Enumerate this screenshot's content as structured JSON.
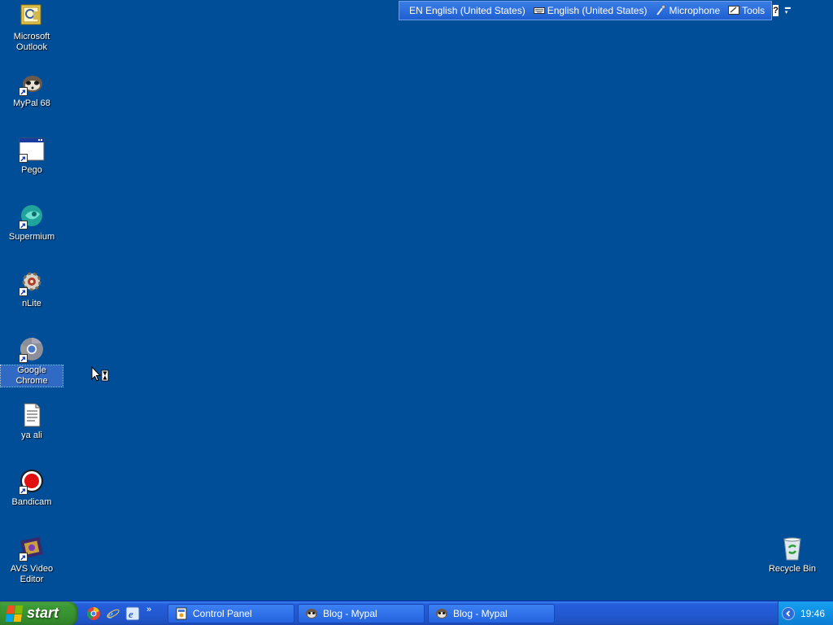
{
  "desktop": {
    "icons": [
      {
        "label": "Microsoft Outlook",
        "icon": "outlook-icon"
      },
      {
        "label": "MyPal 68",
        "icon": "mypal-icon"
      },
      {
        "label": "Pego",
        "icon": "pego-window-icon"
      },
      {
        "label": "Supermium",
        "icon": "supermium-icon"
      },
      {
        "label": "nLite",
        "icon": "nlite-gear-icon"
      },
      {
        "label": "Google Chrome",
        "icon": "chrome-icon",
        "selected": true
      },
      {
        "label": "ya ali",
        "icon": "text-document-icon"
      },
      {
        "label": "Bandicam",
        "icon": "bandicam-record-icon"
      },
      {
        "label": "AVS Video Editor",
        "icon": "avs-film-icon"
      }
    ],
    "recycle_bin": {
      "label": "Recycle Bin",
      "icon": "recycle-bin-icon"
    }
  },
  "language_bar": {
    "language": "EN English (United States)",
    "keyboard": "English (United States)",
    "microphone": "Microphone",
    "tools": "Tools",
    "help": "?"
  },
  "taskbar": {
    "start_label": "start",
    "quick_launch": [
      "chrome-icon",
      "internet-explorer-icon",
      "ie-update-icon"
    ],
    "quick_launch_more": "»",
    "tasks": [
      {
        "label": "Control Panel",
        "icon": "control-panel-icon"
      },
      {
        "label": "Blog - Mypal",
        "icon": "mypal-icon"
      },
      {
        "label": "Blog - Mypal",
        "icon": "mypal-icon"
      }
    ],
    "clock": "19:46"
  },
  "colors": {
    "desktop_background": "#004e98",
    "taskbar_blue": "#245edb",
    "start_green": "#3c9a36",
    "tray_blue": "#0f8ee3"
  }
}
